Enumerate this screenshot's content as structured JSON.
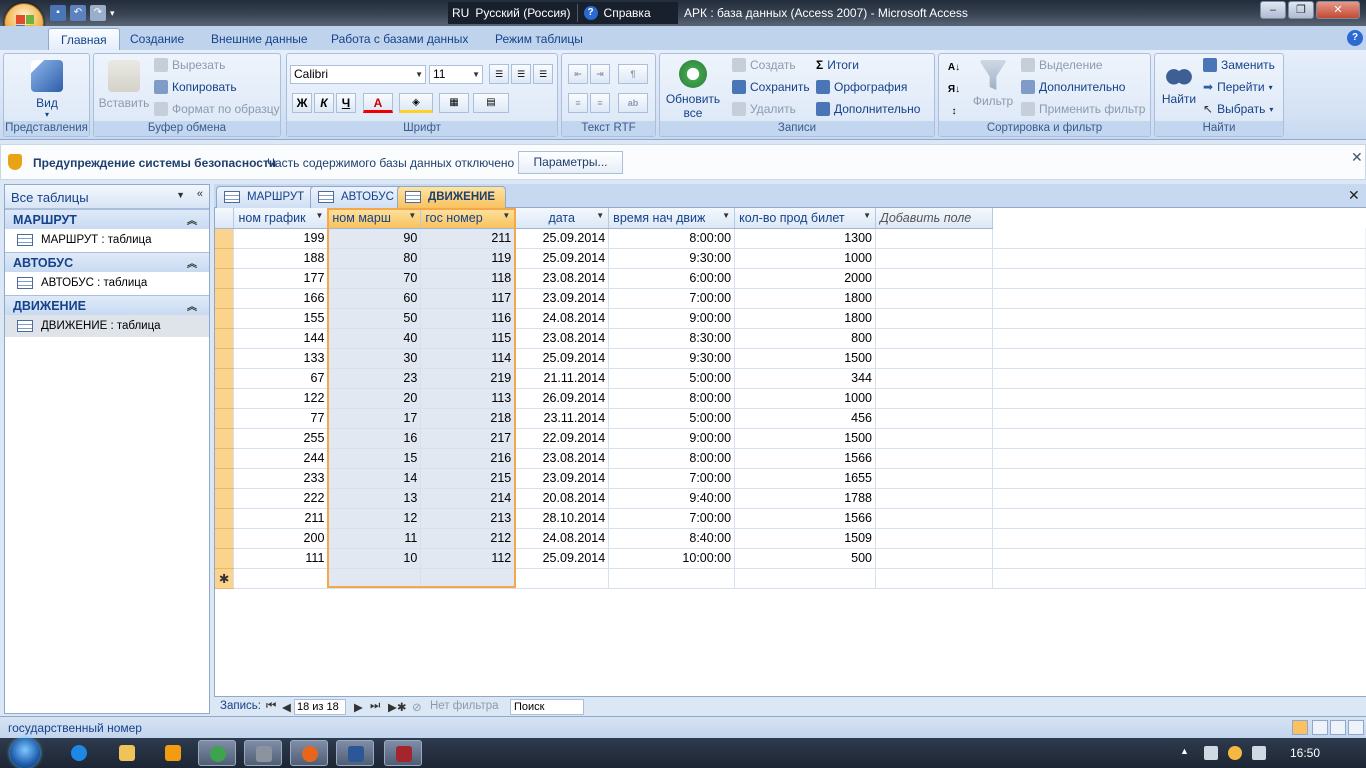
{
  "window": {
    "title": "АРК : база данных (Access 2007) - Microsoft Access",
    "lang": "RU",
    "lang_name": "Русский (Россия)",
    "help": "Справка",
    "min": "–",
    "restore": "❐",
    "close": "✕"
  },
  "ribbon_tabs": [
    "Главная",
    "Создание",
    "Внешние данные",
    "Работа с базами данных",
    "Режим таблицы"
  ],
  "ribbon": {
    "views": {
      "label": "Вид",
      "group": "Представления"
    },
    "clipboard": {
      "paste": "Вставить",
      "cut": "Вырезать",
      "copy": "Копировать",
      "format_painter": "Формат по образцу",
      "group": "Буфер обмена"
    },
    "font": {
      "name": "Calibri",
      "size": "11",
      "bold": "Ж",
      "italic": "К",
      "underline": "Ч",
      "group": "Шрифт"
    },
    "rtf": {
      "group": "Текст RTF"
    },
    "records": {
      "refresh": "Обновить все",
      "new": "Создать",
      "save": "Сохранить",
      "delete": "Удалить",
      "totals": "Итоги",
      "spelling": "Орфография",
      "more": "Дополнительно",
      "group": "Записи"
    },
    "sort": {
      "filter": "Фильтр",
      "selection": "Выделение",
      "advanced": "Дополнительно",
      "toggle": "Применить фильтр",
      "group": "Сортировка и фильтр"
    },
    "find": {
      "find": "Найти",
      "replace": "Заменить",
      "goto": "Перейти",
      "select": "Выбрать",
      "group": "Найти"
    }
  },
  "security": {
    "title": "Предупреждение системы безопасности",
    "message": "Часть содержимого базы данных отключено",
    "button": "Параметры..."
  },
  "nav": {
    "header": "Все таблицы",
    "groups": [
      {
        "name": "МАРШРУТ",
        "item": "МАРШРУТ : таблица"
      },
      {
        "name": "АВТОБУС",
        "item": "АВТОБУС : таблица"
      },
      {
        "name": "ДВИЖЕНИЕ",
        "item": "ДВИЖЕНИЕ : таблица"
      }
    ]
  },
  "doc_tabs": [
    "МАРШРУТ",
    "АВТОБУС",
    "ДВИЖЕНИЕ"
  ],
  "table": {
    "columns": [
      "ном график",
      "ном марш",
      "гос номер",
      "дата",
      "время нач движ",
      "кол-во прод билет",
      "Добавить поле"
    ],
    "rows": [
      [
        "199",
        "90",
        "211",
        "25.09.2014",
        "8:00:00",
        "1300"
      ],
      [
        "188",
        "80",
        "119",
        "25.09.2014",
        "9:30:00",
        "1000"
      ],
      [
        "177",
        "70",
        "118",
        "23.08.2014",
        "6:00:00",
        "2000"
      ],
      [
        "166",
        "60",
        "117",
        "23.09.2014",
        "7:00:00",
        "1800"
      ],
      [
        "155",
        "50",
        "116",
        "24.08.2014",
        "9:00:00",
        "1800"
      ],
      [
        "144",
        "40",
        "115",
        "23.08.2014",
        "8:30:00",
        "800"
      ],
      [
        "133",
        "30",
        "114",
        "25.09.2014",
        "9:30:00",
        "1500"
      ],
      [
        "67",
        "23",
        "219",
        "21.11.2014",
        "5:00:00",
        "344"
      ],
      [
        "122",
        "20",
        "113",
        "26.09.2014",
        "8:00:00",
        "1000"
      ],
      [
        "77",
        "17",
        "218",
        "23.11.2014",
        "5:00:00",
        "456"
      ],
      [
        "255",
        "16",
        "217",
        "22.09.2014",
        "9:00:00",
        "1500"
      ],
      [
        "244",
        "15",
        "216",
        "23.08.2014",
        "8:00:00",
        "1566"
      ],
      [
        "233",
        "14",
        "215",
        "23.09.2014",
        "7:00:00",
        "1655"
      ],
      [
        "222",
        "13",
        "214",
        "20.08.2014",
        "9:40:00",
        "1788"
      ],
      [
        "211",
        "12",
        "213",
        "28.10.2014",
        "7:00:00",
        "1566"
      ],
      [
        "200",
        "11",
        "212",
        "24.08.2014",
        "8:40:00",
        "1509"
      ],
      [
        "111",
        "10",
        "112",
        "25.09.2014",
        "10:00:00",
        "500"
      ]
    ],
    "new_row_marker": "✱"
  },
  "record_nav": {
    "label": "Запись:",
    "position": "18 из 18",
    "filter": "Нет фильтра",
    "search": "Поиск"
  },
  "status": "государственный номер",
  "clock": "16:50",
  "colors": {
    "accent": "#f9c15f",
    "ribbon": "#dbe7f5",
    "text": "#15428b"
  }
}
